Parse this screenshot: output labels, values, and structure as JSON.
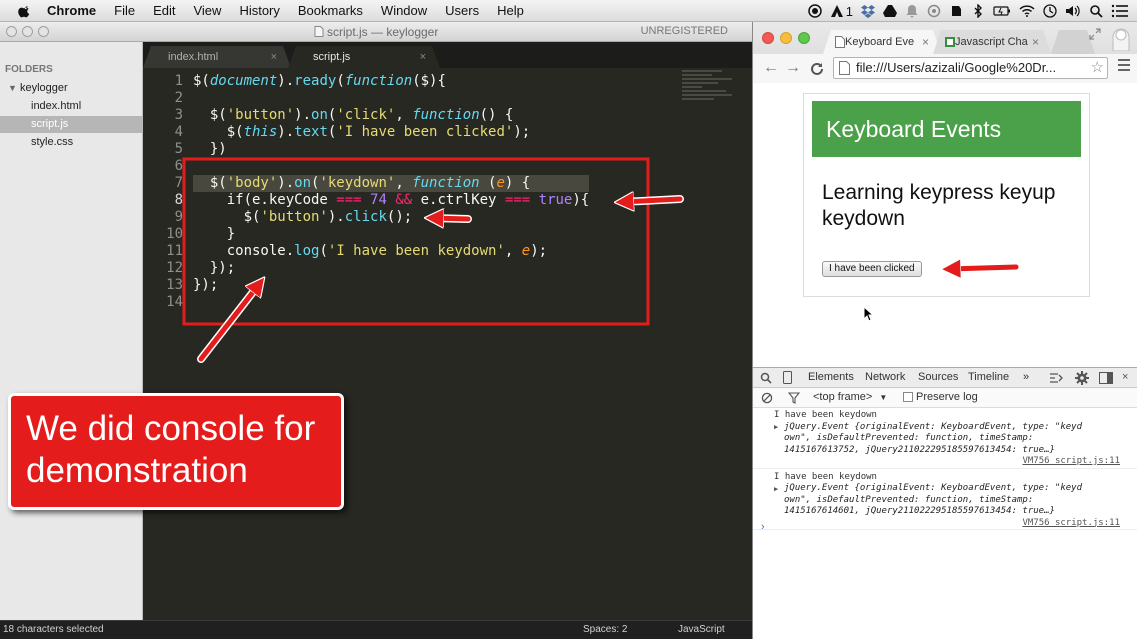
{
  "menubar": {
    "app_name": "Chrome",
    "items": [
      "File",
      "Edit",
      "View",
      "History",
      "Bookmarks",
      "Window",
      "Users",
      "Help"
    ],
    "status_text": "1"
  },
  "sublime": {
    "window_title": "script.js — keylogger",
    "unregistered": "UNREGISTERED",
    "sidebar": {
      "folders_label": "FOLDERS",
      "project": "keylogger",
      "files": [
        "index.html",
        "script.js",
        "style.css"
      ],
      "selected_file": "script.js"
    },
    "tabs": [
      {
        "label": "index.html",
        "active": false
      },
      {
        "label": "script.js",
        "active": true
      }
    ],
    "line_numbers": [
      "1",
      "2",
      "3",
      "4",
      "5",
      "6",
      "7",
      "8",
      "9",
      "10",
      "11",
      "12",
      "13",
      "14"
    ],
    "code_lines": [
      "$(document).ready(function($){",
      "",
      "  $('button').on('click', function() {",
      "    $(this).text('I have been clicked');",
      "  })",
      "",
      "  $('body').on('keydown', function (e) {",
      "    if(e.keyCode === 74 && e.ctrlKey === true){",
      "      $('button').click();",
      "    }",
      "    console.log('I have been keydown', e);",
      "  });",
      "});",
      ""
    ],
    "status": {
      "left": "18 characters selected",
      "spaces": "Spaces: 2",
      "syntax": "JavaScript"
    }
  },
  "chrome": {
    "tabs": [
      {
        "label": "Keyboard Eve",
        "active": true
      },
      {
        "label": "Javascript Cha",
        "active": false
      }
    ],
    "url": "file:///Users/azizali/Google%20Dr...",
    "page": {
      "header": "Keyboard Events",
      "heading": "Learning keypress keyup keydown",
      "button_label": "I have been clicked"
    },
    "devtools": {
      "tabs": [
        "Elements",
        "Network",
        "Sources",
        "Timeline",
        "»"
      ],
      "frame": "<top frame>",
      "preserve_log": "Preserve log",
      "messages": [
        {
          "text": "I have been keydown",
          "obj_line1_a": "jQuery.Event {originalEvent: KeyboardEvent, type: \"keyd",
          "obj_line2": "own\", isDefaultPrevented: function, timeStamp:",
          "obj_line3": "1415167613752, jQuery211022295185597613454: true…}",
          "source": "VM756 script.js:11"
        },
        {
          "text": "I have been keydown",
          "obj_line1_a": "jQuery.Event {originalEvent: KeyboardEvent, type: \"keyd",
          "obj_line2": "own\", isDefaultPrevented: function, timeStamp:",
          "obj_line3": "1415167614601, jQuery211022295185597613454: true…}",
          "source": "VM756 script.js:11"
        }
      ],
      "prompt": "›"
    }
  },
  "annotation": {
    "note": "We did console for demonstration",
    "color": "#e41c1c"
  }
}
